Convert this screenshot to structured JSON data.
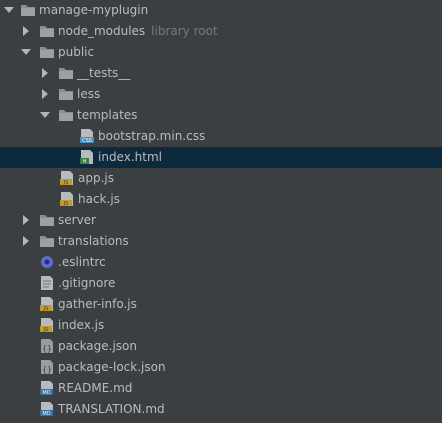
{
  "colors": {
    "background": "#3c3f41",
    "selection": "#0d293e",
    "text": "#bbbbbb",
    "hint": "#787878",
    "folder": "#8c8f92",
    "js_file": "#c49a2c",
    "css_file": "#4a8fbf",
    "html_file": "#3f7a4b",
    "json_file": "#9a9da1",
    "md_file": "#3a6f9a",
    "eslint": "#5b6dcf"
  },
  "tree": {
    "root": {
      "label": "manage-myplugin",
      "icon": "folder-icon",
      "expanded": true
    },
    "node_modules": {
      "label": "node_modules",
      "hint": "library root",
      "icon": "folder-icon",
      "expanded": false
    },
    "public": {
      "label": "public",
      "icon": "folder-icon",
      "expanded": true
    },
    "tests": {
      "label": "__tests__",
      "icon": "folder-icon",
      "expanded": false
    },
    "less": {
      "label": "less",
      "icon": "folder-icon",
      "expanded": false
    },
    "templates": {
      "label": "templates",
      "icon": "folder-icon",
      "expanded": true
    },
    "bootstrap": {
      "label": "bootstrap.min.css",
      "icon": "css-file-icon",
      "badge": "CSS"
    },
    "index_html": {
      "label": "index.html",
      "icon": "html-file-icon",
      "badge": "H",
      "selected": true
    },
    "app_js": {
      "label": "app.js",
      "icon": "js-file-icon",
      "badge": "JS"
    },
    "hack_js": {
      "label": "hack.js",
      "icon": "js-file-icon",
      "badge": "JS"
    },
    "server": {
      "label": "server",
      "icon": "folder-icon",
      "expanded": false
    },
    "translations": {
      "label": "translations",
      "icon": "folder-icon",
      "expanded": false
    },
    "eslintrc": {
      "label": ".eslintrc",
      "icon": "eslint-icon"
    },
    "gitignore": {
      "label": ".gitignore",
      "icon": "text-file-icon"
    },
    "gather_info": {
      "label": "gather-info.js",
      "icon": "js-file-icon",
      "badge": "JS"
    },
    "index_js": {
      "label": "index.js",
      "icon": "js-file-icon",
      "badge": "JS"
    },
    "package_json": {
      "label": "package.json",
      "icon": "json-file-icon"
    },
    "package_lock": {
      "label": "package-lock.json",
      "icon": "json-file-icon"
    },
    "readme": {
      "label": "README.md",
      "icon": "md-file-icon",
      "badge": "MD"
    },
    "translation_md": {
      "label": "TRANSLATION.md",
      "icon": "md-file-icon",
      "badge": "MD"
    }
  }
}
